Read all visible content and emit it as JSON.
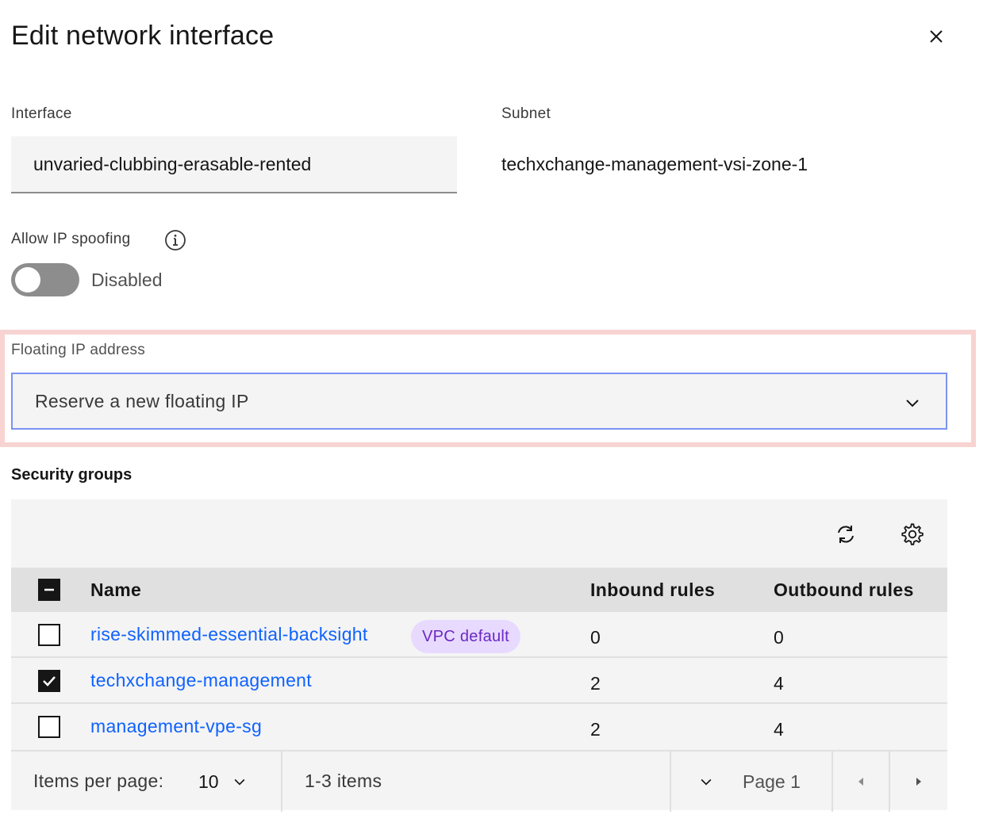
{
  "modal": {
    "title": "Edit network interface",
    "close_icon": "close-icon"
  },
  "interface": {
    "label": "Interface",
    "value": "unvaried-clubbing-erasable-rented"
  },
  "subnet": {
    "label": "Subnet",
    "value": "techxchange-management-vsi-zone-1"
  },
  "ip_spoofing": {
    "label": "Allow IP spoofing",
    "state": "Disabled",
    "enabled": false
  },
  "floating_ip": {
    "label": "Floating IP address",
    "selected": "Reserve a new floating IP"
  },
  "security_groups": {
    "title": "Security groups",
    "columns": [
      "Name",
      "Inbound rules",
      "Outbound rules"
    ],
    "rows": [
      {
        "name": "rise-skimmed-essential-backsight",
        "tag": "VPC default",
        "inbound": "0",
        "outbound": "0",
        "checked": false
      },
      {
        "name": "techxchange-management",
        "tag": "",
        "inbound": "2",
        "outbound": "4",
        "checked": true
      },
      {
        "name": "management-vpe-sg",
        "tag": "",
        "inbound": "2",
        "outbound": "4",
        "checked": false
      }
    ]
  },
  "pagination": {
    "items_per_page_label": "Items per page:",
    "items_per_page_value": "10",
    "range_text": "1-3 items",
    "page_text": "Page 1"
  },
  "colors": {
    "link": "#0f62fe",
    "tag_bg": "#e8daff",
    "tag_text": "#6929c4",
    "highlight": "#f7d3d2",
    "focus_border": "#7b93f2"
  }
}
